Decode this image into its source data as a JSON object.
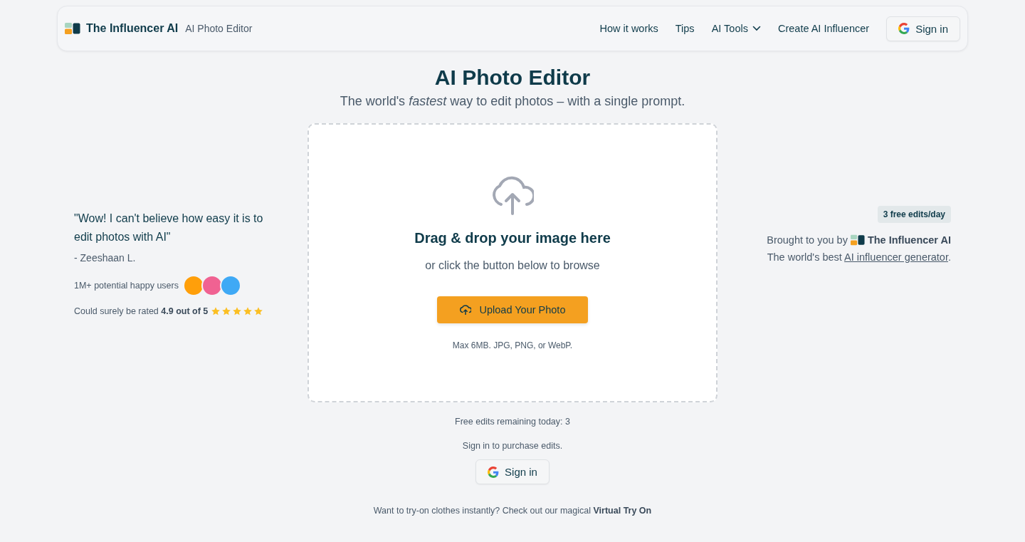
{
  "header": {
    "brand": "The Influencer AI",
    "product": "AI Photo Editor",
    "nav": [
      {
        "label": "How it works",
        "kind": "link"
      },
      {
        "label": "Tips",
        "kind": "link"
      },
      {
        "label": "AI Tools",
        "kind": "dropdown"
      },
      {
        "label": "Create AI Influencer",
        "kind": "link"
      }
    ],
    "sign_in": "Sign in"
  },
  "title": "AI Photo Editor",
  "subtitle": "The world's *fastest* way to edit photos – with a single prompt.",
  "testimonial": {
    "quote": "\"Wow! I can't believe how easy it is to edit photos with AI\"",
    "author": "- Zeeshaan L.",
    "users": "1M+ potential happy users",
    "avatars": [
      {
        "color": "#ff9f0a"
      },
      {
        "color": "#f06292"
      },
      {
        "color": "#3fa9f5"
      }
    ],
    "rating": "Could surely be rated **4.9 out of 5**",
    "stars": 5
  },
  "dropzone": {
    "heading": "Drag & drop your image here",
    "hint": "or click the button below to browse",
    "button": "Upload Your Photo",
    "limits": "Max 6MB. JPG, PNG, or WebP."
  },
  "promo": {
    "badge": "3 free edits/day",
    "brought_by": "Brought to you by",
    "brand": "The Influencer AI",
    "tagline_before": "The world's best ",
    "link": "AI influencer generator",
    "tagline_after": "."
  },
  "remaining": "Free edits remaining today: 3",
  "purchase_note": "Sign in to purchase edits.",
  "sign_in": "Sign in",
  "footer_note": "Want to try-on clothes instantly? Check out our magical **Virtual Try On**"
}
